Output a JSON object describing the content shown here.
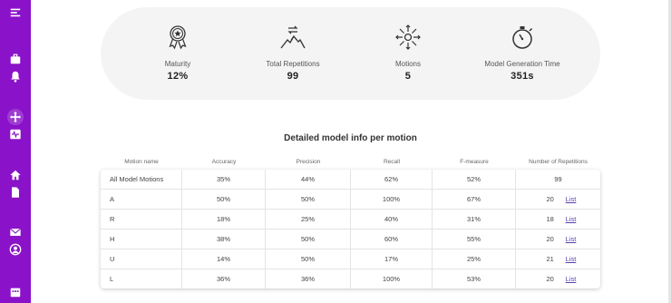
{
  "summary": {
    "maturity": {
      "label": "Maturity",
      "value": "12%",
      "icon": "award-ribbon-icon"
    },
    "total_repetitions": {
      "label": "Total Repetitions",
      "value": "99",
      "icon": "repeat-mountain-icon"
    },
    "motions": {
      "label": "Motions",
      "value": "5",
      "icon": "move-arrows-icon"
    },
    "model_generation_time": {
      "label": "Model Generation Time",
      "value": "351s",
      "icon": "stopwatch-icon"
    }
  },
  "table": {
    "title": "Detailed model info per motion",
    "headers": [
      "Motion name",
      "Accuracy",
      "Precision",
      "Recall",
      "F-measure",
      "Number of Repetitions"
    ],
    "link_label": "List",
    "rows": [
      {
        "name": "All Model Motions",
        "accuracy": "35%",
        "precision": "44%",
        "recall": "62%",
        "fmeasure": "52%",
        "reps": "99",
        "has_list": false
      },
      {
        "name": "A",
        "accuracy": "50%",
        "precision": "50%",
        "recall": "100%",
        "fmeasure": "67%",
        "reps": "20",
        "has_list": true
      },
      {
        "name": "R",
        "accuracy": "18%",
        "precision": "25%",
        "recall": "40%",
        "fmeasure": "31%",
        "reps": "18",
        "has_list": true
      },
      {
        "name": "H",
        "accuracy": "38%",
        "precision": "50%",
        "recall": "60%",
        "fmeasure": "55%",
        "reps": "20",
        "has_list": true
      },
      {
        "name": "U",
        "accuracy": "14%",
        "precision": "50%",
        "recall": "17%",
        "fmeasure": "25%",
        "reps": "21",
        "has_list": true
      },
      {
        "name": "L",
        "accuracy": "36%",
        "precision": "36%",
        "recall": "100%",
        "fmeasure": "53%",
        "reps": "20",
        "has_list": true
      }
    ]
  },
  "sidebar": {
    "color": "#8a12c9",
    "icons": [
      "menu-icon",
      "briefcase-icon",
      "bell-icon",
      "move-icon",
      "waveform-icon",
      "home-icon",
      "document-icon",
      "mail-icon",
      "user-icon",
      "calendar-icon"
    ]
  }
}
